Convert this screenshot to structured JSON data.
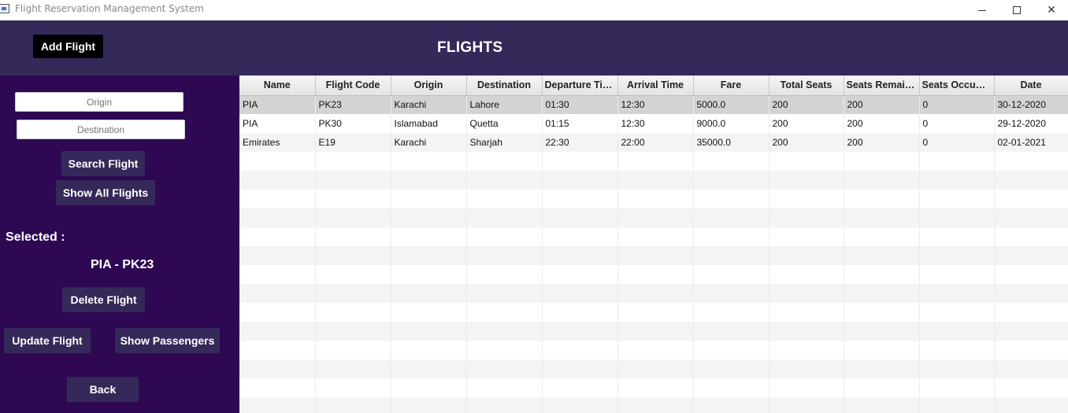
{
  "window": {
    "title": "Flight Reservation Management System",
    "minimize_glyph": "minimize-icon",
    "maximize_glyph": "maximize-icon",
    "close_glyph": "✕"
  },
  "header": {
    "add_flight_label": "Add Flight",
    "page_title": "FLIGHTS"
  },
  "sidebar": {
    "origin_placeholder": "Origin",
    "destination_placeholder": "Destination",
    "search_label": "Search Flight",
    "show_all_label": "Show All Flights",
    "selected_label": "Selected :",
    "selected_value": "PIA - PK23",
    "delete_label": "Delete Flight",
    "update_label": "Update Flight",
    "passengers_label": "Show Passengers",
    "back_label": "Back"
  },
  "table": {
    "columns": [
      "Name",
      "Flight Code",
      "Origin",
      "Destination",
      "Departure Time",
      "Arrival Time",
      "Fare",
      "Total Seats",
      "Seats Remaini...",
      "Seats Occupied",
      "Date"
    ],
    "rows": [
      [
        "PIA",
        "PK23",
        "Karachi",
        "Lahore",
        "01:30",
        "12:30",
        "5000.0",
        "200",
        "200",
        "0",
        "30-12-2020"
      ],
      [
        "PIA",
        "PK30",
        "Islamabad",
        "Quetta",
        "01:15",
        "12:30",
        "9000.0",
        "200",
        "200",
        "0",
        "29-12-2020"
      ],
      [
        "Emirates",
        "E19",
        "Karachi",
        "Sharjah",
        "22:30",
        "22:00",
        "35000.0",
        "200",
        "200",
        "0",
        "02-01-2021"
      ]
    ],
    "selected_row": 0
  },
  "colors": {
    "header_bg": "#35295a",
    "sidebar_bg": "#2e0853",
    "button_bg": "#35295a",
    "selected_row_bg": "#d3d3d3"
  }
}
